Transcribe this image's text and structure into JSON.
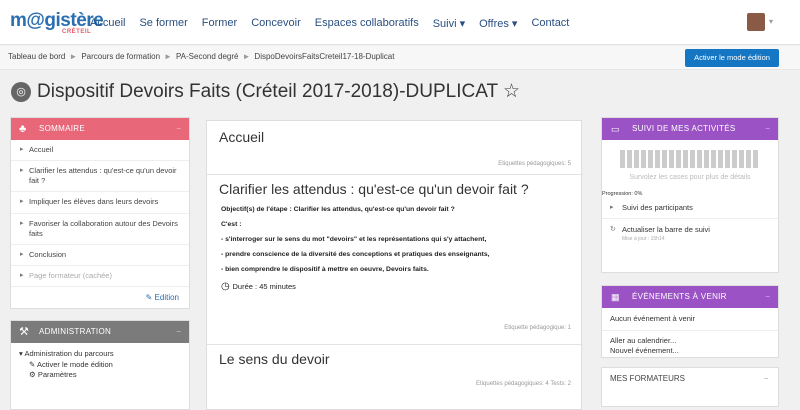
{
  "topbar": {
    "logo": "m@gistère",
    "logo_sub": "CRÉTEIL",
    "nav": [
      "Accueil",
      "Se former",
      "Former",
      "Concevoir",
      "Espaces collaboratifs",
      "Suivi ▾",
      "Offres ▾",
      "Contact"
    ]
  },
  "breadcrumb": [
    "Tableau de bord",
    "Parcours de formation",
    "PA-Second degré",
    "DispoDevoirsFaitsCreteil17-18-Duplicat"
  ],
  "edit_button": "Activer le mode édition",
  "page_title": "Dispositif Devoirs Faits (Créteil 2017-2018)-DUPLICAT ☆",
  "sommaire": {
    "title": "SOMMAIRE",
    "items": [
      "Accueil",
      "Clarifier les attendus : qu'est-ce qu'un devoir fait ?",
      "Impliquer les élèves dans leurs devoirs",
      "Favoriser la collaboration autour des Devoirs faits",
      "Conclusion",
      "Page formateur (cachée)"
    ],
    "edition": "Edition"
  },
  "administration": {
    "title": "ADMINISTRATION",
    "group": "Administration du parcours",
    "items": [
      "Activer le mode édition",
      "Paramètres"
    ]
  },
  "main": {
    "sections": [
      {
        "title": "Accueil",
        "tag": "Etiquettes pédagogiques: 5"
      },
      {
        "title": "Clarifier les attendus : qu'est-ce qu'un devoir fait ?",
        "lines": [
          "Objectif(s) de l'étape : Clarifier les attendus, qu'est-ce qu'un devoir fait ?",
          "C'est :",
          "- s'interroger sur le sens du mot \"devoirs\" et les représentations qui s'y attachent,",
          "- prendre conscience de la diversité des conceptions et pratiques des enseignants,",
          "- bien comprendre le dispositif à mettre en oeuvre, Devoirs faits."
        ],
        "duration": "Durée : 45 minutes",
        "tag": "Etiquette pédagogique: 1"
      },
      {
        "title": "Le sens du devoir",
        "tag": "Etiquettes pédagogiques: 4  Tests: 2"
      }
    ]
  },
  "suivi": {
    "title": "SUIVI DE MES ACTIVITÉS",
    "progress": 0,
    "hover": "Survolez les cases pour plus de détails",
    "progression": "Progression: 0%",
    "links": [
      "Suivi des participants",
      "Actualiser la barre de suivi"
    ],
    "updated": "Mise à jour : 15h14"
  },
  "events": {
    "title": "ÉVÉNEMENTS À VENIR",
    "none": "Aucun événement à venir",
    "calendar": "Aller au calendrier...",
    "new": "Nouvel événement..."
  },
  "formateurs": {
    "title": "MES FORMATEURS"
  },
  "colors": {
    "sommaire": "#e86778",
    "admin": "#7b7b7b",
    "purple": "#9a52c5",
    "blue": "#1577c4"
  }
}
